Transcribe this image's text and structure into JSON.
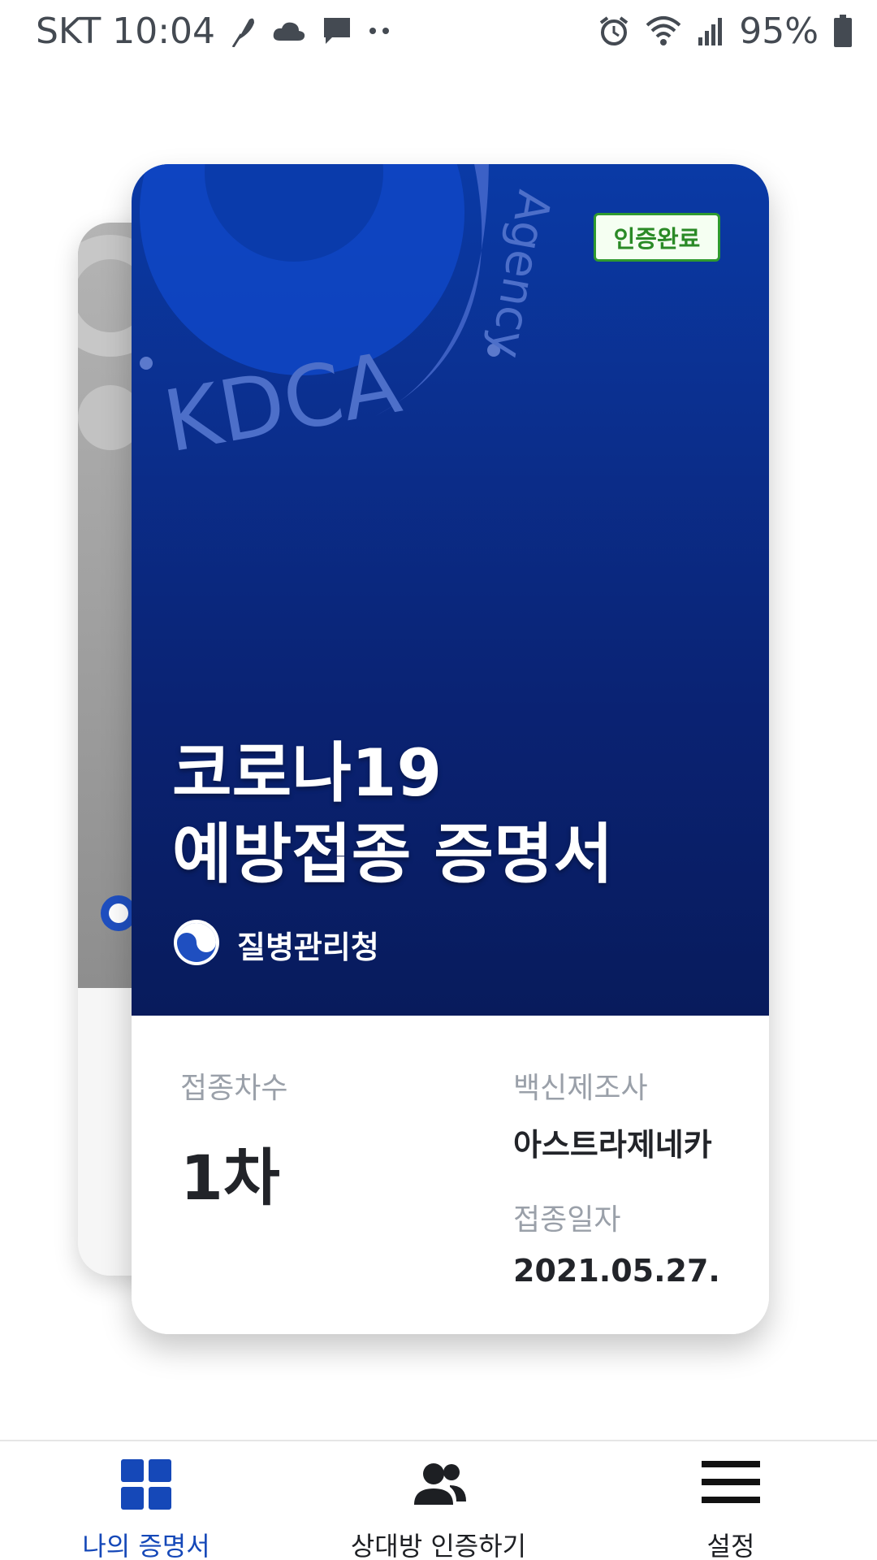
{
  "status_bar": {
    "carrier_time": "SKT 10:04",
    "battery": "95%",
    "icons": [
      "feather-icon",
      "cloud-icon",
      "message-icon",
      "more-dots-icon",
      "alarm-icon",
      "wifi-icon",
      "signal-icon",
      "battery-icon"
    ]
  },
  "card": {
    "badge": "인증완료",
    "watermark_text": "KDCA",
    "watermark_agency": "Agency",
    "title_line1": "코로나19",
    "title_line2": "예방접종 증명서",
    "issuer": "질병관리청",
    "dose_label": "접종차수",
    "dose_value": "1차",
    "manufacturer_label": "백신제조사",
    "manufacturer_value": "아스트라제네카",
    "date_label": "접종일자",
    "date_value": "2021.05.27."
  },
  "nav": {
    "items": [
      {
        "label": "나의 증명서",
        "icon": "grid-icon",
        "active": true
      },
      {
        "label": "상대방 인증하기",
        "icon": "people-icon",
        "active": false
      },
      {
        "label": "설정",
        "icon": "menu-icon",
        "active": false
      }
    ]
  },
  "colors": {
    "card_blue": "#0b2f8e",
    "active_nav": "#1548b8",
    "badge_green": "#2f9a2f"
  }
}
